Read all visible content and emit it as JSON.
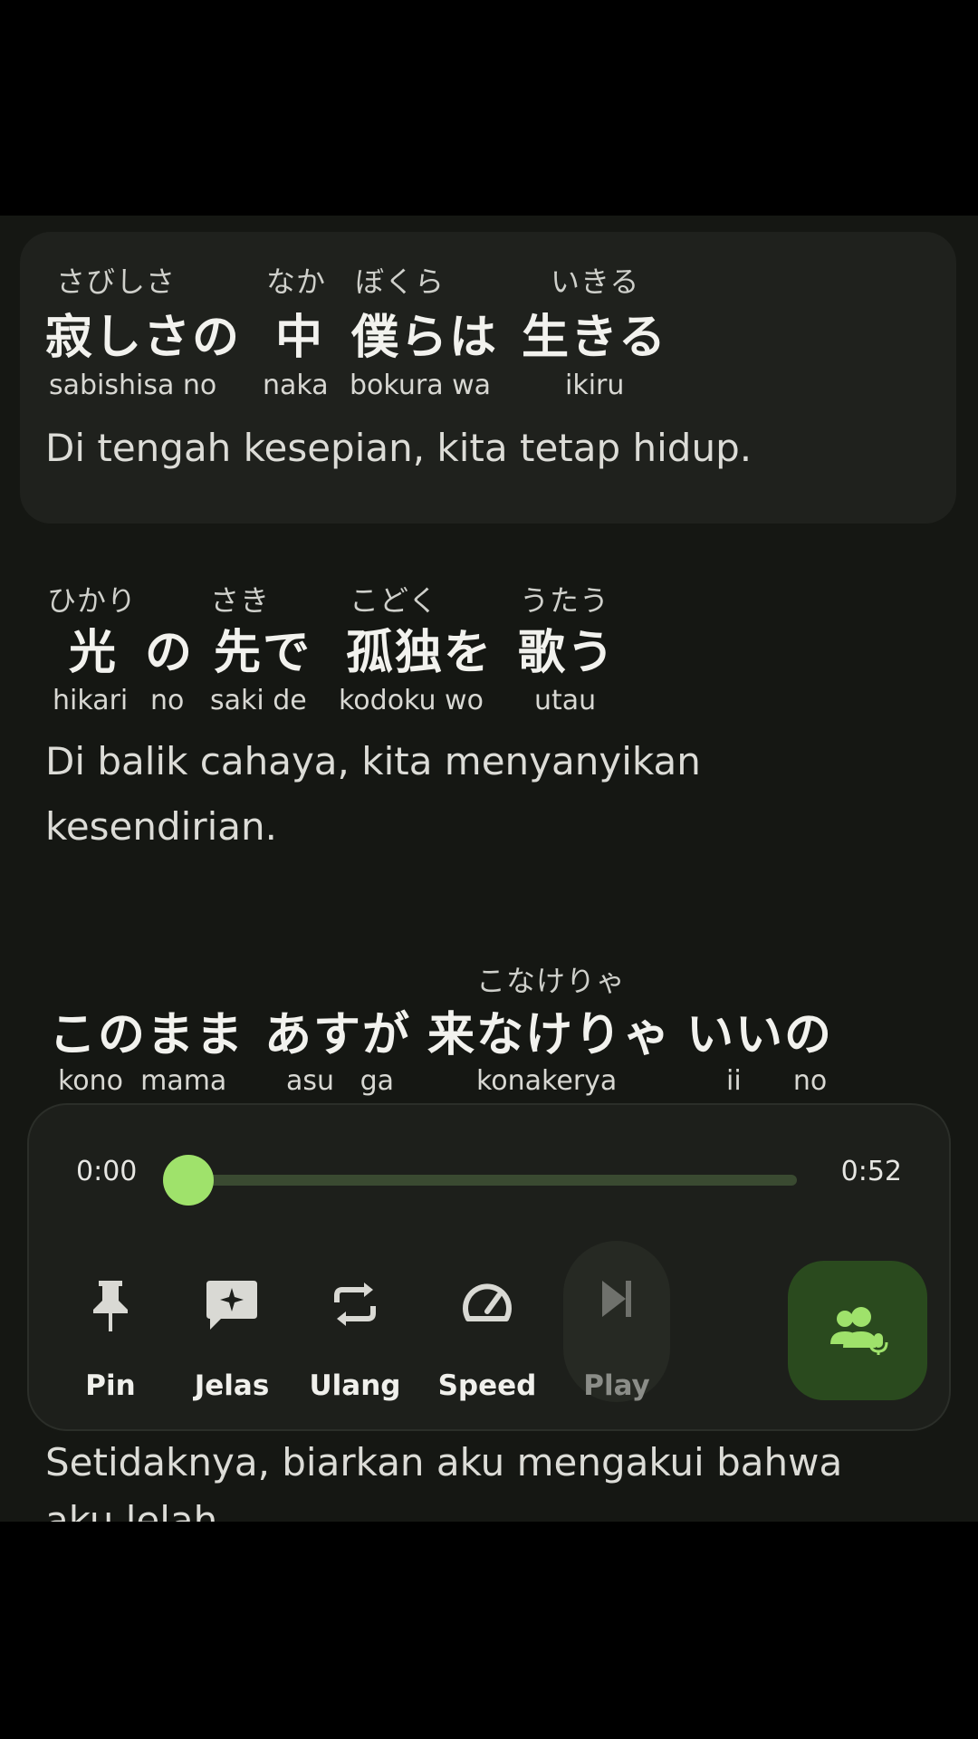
{
  "lyrics": [
    {
      "words": [
        {
          "furigana": "さびしさ",
          "jp": "寂しさの",
          "romaji": "sabishisa no"
        },
        {
          "furigana": "なか",
          "jp": "中",
          "romaji": "naka"
        },
        {
          "furigana": "ぼくら",
          "jp": "僕らは",
          "romaji": "bokura wa"
        },
        {
          "furigana": "いきる",
          "jp": "生きる",
          "romaji": "ikiru"
        }
      ],
      "translation": "Di tengah kesepian, kita tetap hidup."
    },
    {
      "words": [
        {
          "furigana": "ひかり",
          "jp": "光",
          "romaji": "hikari"
        },
        {
          "furigana": "",
          "jp": "の",
          "romaji": "no"
        },
        {
          "furigana": "さき",
          "jp": "先で",
          "romaji": "saki de"
        },
        {
          "furigana": "こどく",
          "jp": "孤独を",
          "romaji": "kodoku wo"
        },
        {
          "furigana": "うたう",
          "jp": "歌う",
          "romaji": "utau"
        }
      ],
      "translation_line1": "Di balik cahaya, kita menyanyikan",
      "translation_line2": "kesendirian."
    },
    {
      "words": [
        {
          "furigana": "",
          "jp": "このまま",
          "romaji": "kono  mama"
        },
        {
          "furigana": "",
          "jp": "あすが",
          "romaji": "asu   ga"
        },
        {
          "furigana": "こなけりゃ",
          "jp": "来なけりゃ",
          "romaji": "konakerya"
        },
        {
          "furigana": "",
          "jp": "いいの",
          "romaji": "ii      no"
        }
      ],
      "translation_line1": "Setidaknya, biarkan aku mengakui bahwa",
      "translation_line2": "aku lelah"
    }
  ],
  "player": {
    "current_time": "0:00",
    "total_time": "0:52",
    "progress": 0.0,
    "controls": {
      "pin": "Pin",
      "explain": "Jelas",
      "repeat": "Ulang",
      "speed": "Speed",
      "play": "Play"
    }
  },
  "colors": {
    "accent": "#9fe26b",
    "background": "#151713",
    "voice_button": "#2a4a1e"
  }
}
